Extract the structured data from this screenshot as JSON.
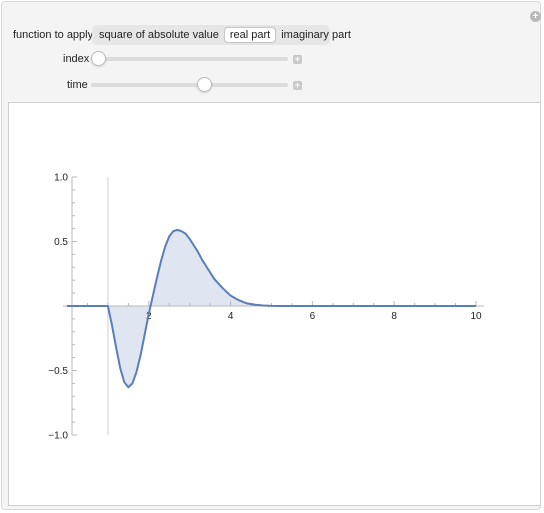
{
  "controls": {
    "function_label": "function to apply",
    "options": [
      "square of absolute value",
      "real part",
      "imaginary part"
    ],
    "selected_index": 1,
    "index_label": "index",
    "index_fraction": 0.0,
    "time_label": "time",
    "time_fraction": 0.58
  },
  "icons": {
    "corner": "plus-circle-icon",
    "stepper": "plus-square-icon"
  },
  "chart_data": {
    "type": "area",
    "title": "",
    "xlabel": "",
    "ylabel": "",
    "xlim": [
      0,
      10
    ],
    "ylim": [
      -1.0,
      1.0
    ],
    "x_ticks": [
      2,
      4,
      6,
      8,
      10
    ],
    "x_tick_labels": [
      "2",
      "4",
      "6",
      "8",
      "10"
    ],
    "y_ticks": [
      1.0,
      0.5,
      -0.5,
      -1.0
    ],
    "y_tick_labels": [
      "1.0",
      "0.5",
      "−0.5",
      "−1.0"
    ],
    "grid": false,
    "line_color": "#5a7fb8",
    "fill_color": "#dfe6f1",
    "series": [
      {
        "x": [
          0,
          0.5,
          0.9,
          1.0,
          1.1,
          1.2,
          1.3,
          1.4,
          1.5,
          1.6,
          1.7,
          1.8,
          1.9,
          2.0,
          2.1,
          2.2,
          2.3,
          2.4,
          2.5,
          2.6,
          2.7,
          2.8,
          2.9,
          3.0,
          3.1,
          3.2,
          3.3,
          3.4,
          3.5,
          3.6,
          3.8,
          4.0,
          4.2,
          4.4,
          4.6,
          4.8,
          5.0,
          5.2,
          5.5,
          6,
          8,
          10
        ],
        "y": [
          0,
          0,
          0,
          0,
          -0.15,
          -0.32,
          -0.48,
          -0.59,
          -0.63,
          -0.6,
          -0.51,
          -0.38,
          -0.22,
          -0.06,
          0.08,
          0.22,
          0.35,
          0.46,
          0.54,
          0.58,
          0.59,
          0.58,
          0.56,
          0.52,
          0.47,
          0.42,
          0.36,
          0.31,
          0.26,
          0.21,
          0.14,
          0.08,
          0.045,
          0.02,
          0.01,
          0.004,
          0.001,
          0,
          0,
          0,
          0,
          0
        ]
      }
    ]
  }
}
